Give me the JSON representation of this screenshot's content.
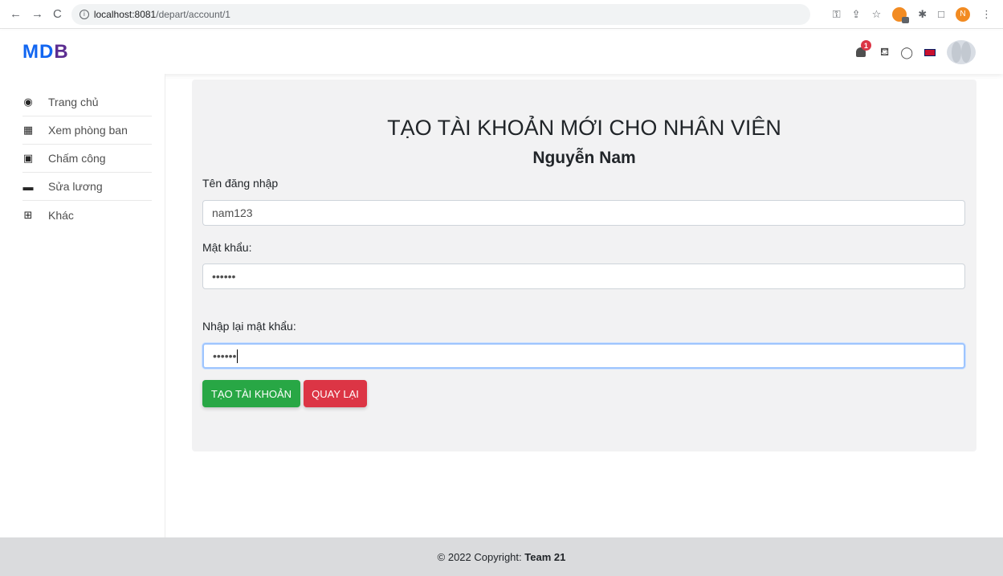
{
  "browser": {
    "back": "←",
    "forward": "→",
    "reload": "C",
    "url_host": "localhost:8081",
    "url_path": "/depart/account/1",
    "profile_initial": "N"
  },
  "header": {
    "logo_m": "M",
    "logo_d": "D",
    "logo_b": "B",
    "notification_count": "1"
  },
  "sidebar": {
    "items": [
      {
        "label": "Trang chủ",
        "icon": "tachometer-icon"
      },
      {
        "label": "Xem phòng ban",
        "icon": "building-icon"
      },
      {
        "label": "Chấm công",
        "icon": "calendar-icon"
      },
      {
        "label": "Sửa lương",
        "icon": "money-bill-icon"
      },
      {
        "label": "Khác",
        "icon": "table-icon"
      }
    ]
  },
  "form": {
    "title": "TẠO TÀI KHOẢN MỚI CHO NHÂN VIÊN",
    "employee_name": "Nguyễn Nam",
    "username_label": "Tên đăng nhập",
    "username_value": "nam123",
    "password_label": "Mật khẩu:",
    "password_value": "••••••",
    "confirm_label": "Nhập lại mật khẩu:",
    "confirm_value": "••••••",
    "create_button": "TẠO TÀI KHOẢN",
    "back_button": "QUAY LẠI"
  },
  "footer": {
    "copyright": "© 2022 Copyright:",
    "team": "Team 21"
  },
  "colors": {
    "create": "#28a745",
    "back": "#dc3545",
    "card": "#f2f2f3",
    "footer": "#dadbdd"
  }
}
